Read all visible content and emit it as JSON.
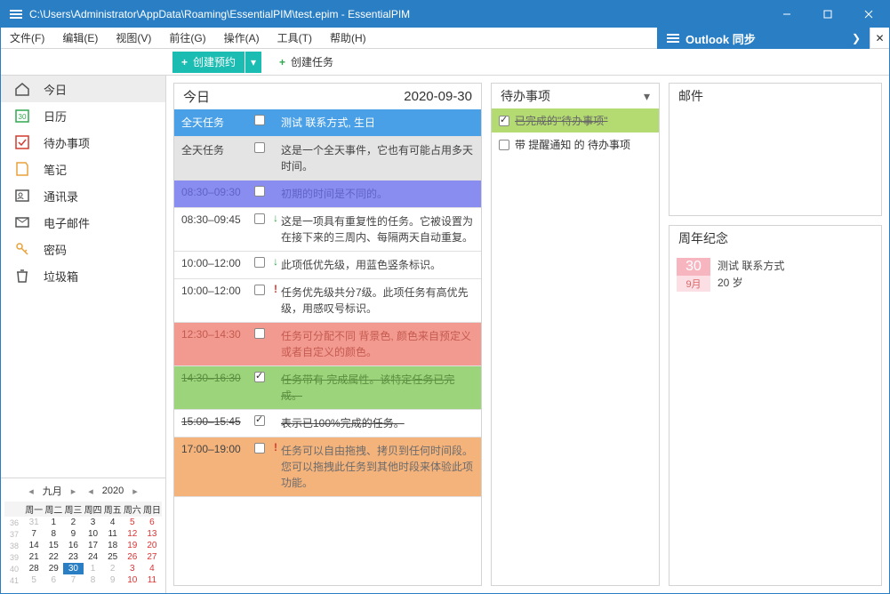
{
  "window": {
    "title": "C:\\Users\\Administrator\\AppData\\Roaming\\EssentialPIM\\test.epim - EssentialPIM"
  },
  "menu": {
    "file": "文件(F)",
    "edit": "编辑(E)",
    "view": "视图(V)",
    "go": "前往(G)",
    "actions": "操作(A)",
    "tools": "工具(T)",
    "help": "帮助(H)"
  },
  "sync_header": {
    "label": "Outlook 同步"
  },
  "toolbar": {
    "create_appt": "创建预约",
    "create_task": "创建任务"
  },
  "sidebar": {
    "items": [
      {
        "label": "今日"
      },
      {
        "label": "日历"
      },
      {
        "label": "待办事项"
      },
      {
        "label": "笔记"
      },
      {
        "label": "通讯录"
      },
      {
        "label": "电子邮件"
      },
      {
        "label": "密码"
      },
      {
        "label": "垃圾箱"
      }
    ]
  },
  "minical": {
    "month_label": "九月",
    "year_label": "2020",
    "dow": [
      "周一",
      "周二",
      "周三",
      "周四",
      "周五",
      "周六",
      "周日"
    ],
    "rows": [
      {
        "wk": "36",
        "d": [
          "31",
          "1",
          "2",
          "3",
          "4",
          "5",
          "6"
        ],
        "dim": [
          0
        ]
      },
      {
        "wk": "37",
        "d": [
          "7",
          "8",
          "9",
          "10",
          "11",
          "12",
          "13"
        ]
      },
      {
        "wk": "38",
        "d": [
          "14",
          "15",
          "16",
          "17",
          "18",
          "19",
          "20"
        ]
      },
      {
        "wk": "39",
        "d": [
          "21",
          "22",
          "23",
          "24",
          "25",
          "26",
          "27"
        ]
      },
      {
        "wk": "40",
        "d": [
          "28",
          "29",
          "30",
          "1",
          "2",
          "3",
          "4"
        ],
        "dim": [
          3,
          4,
          5,
          6
        ],
        "today": 2
      },
      {
        "wk": "41",
        "d": [
          "5",
          "6",
          "7",
          "8",
          "9",
          "10",
          "11"
        ],
        "dim": [
          0,
          1,
          2,
          3,
          4,
          5,
          6
        ]
      }
    ]
  },
  "today": {
    "title": "今日",
    "date": "2020-09-30"
  },
  "schedule": [
    {
      "time": "全天任务",
      "text": "测试 联系方式, 生日",
      "cls": "row-blue"
    },
    {
      "time": "全天任务",
      "text": "这是一个全天事件，它也有可能占用多天时间。",
      "cls": "row-grey"
    },
    {
      "time": "08:30–09:30",
      "text": "初期的时间是不同的。",
      "cls": "row-purple"
    },
    {
      "time": "08:30–09:45",
      "text": "这是一项具有重复性的任务。它被设置为在接下来的三周内、每隔两天自动重复。",
      "pri": "low"
    },
    {
      "time": "10:00–12:00",
      "text": "此项低优先级，用蓝色竖条标识。",
      "pri": "low"
    },
    {
      "time": "10:00–12:00",
      "text": "任务优先级共分7级。此项任务有高优先级，用感叹号标识。",
      "pri": "high"
    },
    {
      "time": "12:30–14:30",
      "text": "任务可分配不同 背景色, 颜色来自预定义或者自定义的颜色。",
      "cls": "row-red"
    },
    {
      "time": "14:30–16:30",
      "text": "任务带有 完成属性。该特定任务已完成。",
      "cls": "row-green",
      "checked": true
    },
    {
      "time": "15:00–15:45",
      "text": "表示已100%完成的任务。",
      "strike": true,
      "checked": true
    },
    {
      "time": "17:00–19:00",
      "text": "任务可以自由拖拽、拷贝到任何时间段。您可以拖拽此任务到其他时段来体验此项功能。",
      "cls": "row-orange",
      "pri": "high"
    }
  ],
  "todo": {
    "title": "待办事项",
    "items": [
      {
        "label": "已完成的\"待办事项\"",
        "done": true
      },
      {
        "label": "带 提醒通知 的 待办事项",
        "done": false
      }
    ]
  },
  "mail": {
    "title": "邮件"
  },
  "anniv": {
    "title": "周年纪念",
    "day": "30",
    "month": "9月",
    "name": "测试 联系方式",
    "age": "20 岁"
  }
}
